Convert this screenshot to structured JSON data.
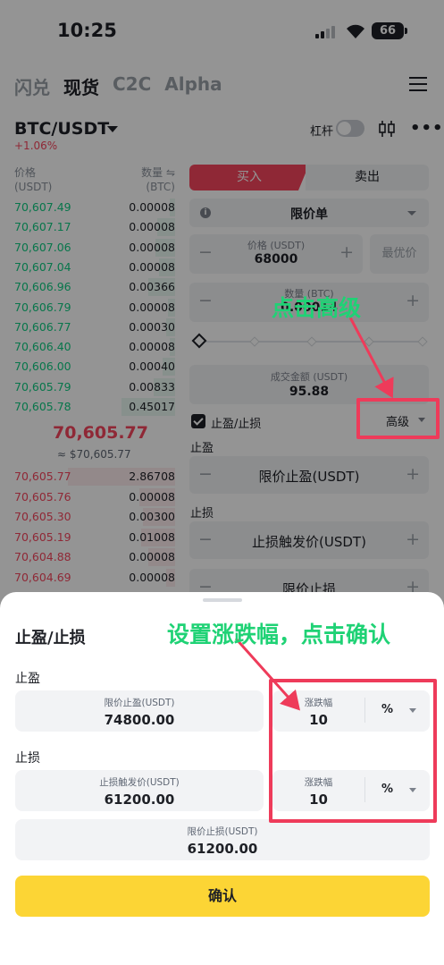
{
  "status_bar": {
    "time": "10:25",
    "battery": "66"
  },
  "nav": {
    "tabs": [
      "闪兑",
      "现货",
      "C2C",
      "Alpha"
    ],
    "active_tab": "现货"
  },
  "header": {
    "pair": "BTC/USDT",
    "change": "+1.06%",
    "leverage_label": "杠杆"
  },
  "orderbook": {
    "price_header": [
      "价格",
      "(USDT)"
    ],
    "qty_header": [
      "数量 ⇋",
      "(BTC)"
    ],
    "bids": [
      {
        "price": "70,607.49",
        "qty": "0.00008"
      },
      {
        "price": "70,607.17",
        "qty": "0.00008"
      },
      {
        "price": "70,607.06",
        "qty": "0.00008"
      },
      {
        "price": "70,607.04",
        "qty": "0.00008"
      },
      {
        "price": "70,606.96",
        "qty": "0.00366"
      },
      {
        "price": "70,606.79",
        "qty": "0.00008"
      },
      {
        "price": "70,606.77",
        "qty": "0.00030"
      },
      {
        "price": "70,606.40",
        "qty": "0.00008"
      },
      {
        "price": "70,606.00",
        "qty": "0.00040"
      },
      {
        "price": "70,605.79",
        "qty": "0.00833"
      },
      {
        "price": "70,605.78",
        "qty": "0.45017"
      }
    ],
    "mid_price": "70,605.77",
    "mid_sub": "≈ $70,605.77",
    "asks": [
      {
        "price": "70,605.77",
        "qty": "2.86708"
      },
      {
        "price": "70,605.76",
        "qty": "0.00008"
      },
      {
        "price": "70,605.30",
        "qty": "0.00300"
      },
      {
        "price": "70,605.19",
        "qty": "0.01008"
      },
      {
        "price": "70,604.88",
        "qty": "0.00008"
      },
      {
        "price": "70,604.69",
        "qty": "0.00008"
      }
    ]
  },
  "order_form": {
    "buy_label": "买入",
    "sell_label": "卖出",
    "order_type": "限价单",
    "price_label": "价格 (USDT)",
    "price_value": "68000",
    "best_price_label": "最优价",
    "qty_label": "数量 (BTC)",
    "qty_value": "0.00014",
    "amount_label": "成交金额 (USDT)",
    "amount_value": "95.88",
    "tpsl_label": "止盈/止损",
    "advanced_label": "高级",
    "tp_section": "止盈",
    "tp_placeholder": "限价止盈(USDT)",
    "sl_section": "止损",
    "sl_placeholder": "止损触发价(USDT)",
    "sl_limit_placeholder": "限价止损"
  },
  "sheet": {
    "title": "止盈/止损",
    "tp_label": "止盈",
    "tp_price_label": "限价止盈(USDT)",
    "tp_price_value": "74800.00",
    "tp_pct_label": "涨跌幅",
    "tp_pct_value": "10",
    "tp_unit": "%",
    "sl_label": "止损",
    "sl_trigger_label": "止损触发价(USDT)",
    "sl_trigger_value": "61200.00",
    "sl_pct_label": "涨跌幅",
    "sl_pct_value": "10",
    "sl_unit": "%",
    "sl_limit_label": "限价止损(USDT)",
    "sl_limit_value": "61200.00",
    "confirm_label": "确认"
  },
  "annotations": {
    "click_advanced": "点击高级",
    "set_and_confirm": "设置涨跌幅，点击确认",
    "text_color": "#1fd275",
    "highlight_color": "#ee3b5a"
  }
}
